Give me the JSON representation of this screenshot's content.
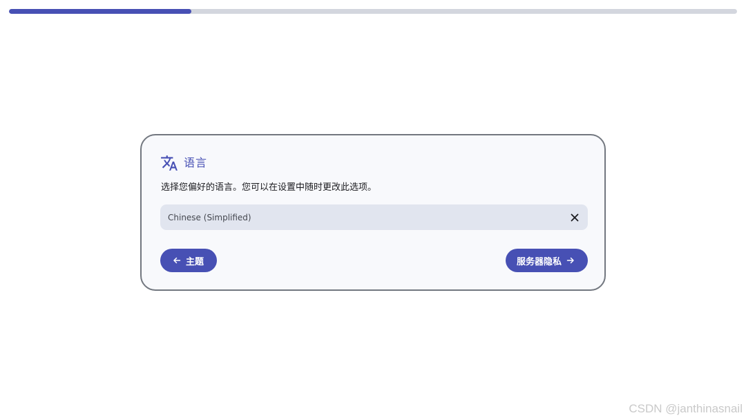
{
  "progress": {
    "value_percent": 25,
    "accent": "#4750b4",
    "track": "#d3d6de"
  },
  "language_card": {
    "icon": "translate-icon",
    "title": "语言",
    "description": "选择您偏好的语言。您可以在设置中随时更改此选项。",
    "select": {
      "value": "Chinese (Simplified)",
      "clear_icon": "close-icon"
    }
  },
  "navigation": {
    "back": {
      "label": "主题",
      "icon": "arrow-left-icon"
    },
    "next": {
      "label": "服务器隐私",
      "icon": "arrow-right-icon"
    }
  },
  "watermark": "CSDN @janthinasnail",
  "colors": {
    "accent": "#4750b4",
    "card_bg": "#f8f9fc",
    "field_bg": "#e1e5ef",
    "border": "#72777f"
  }
}
